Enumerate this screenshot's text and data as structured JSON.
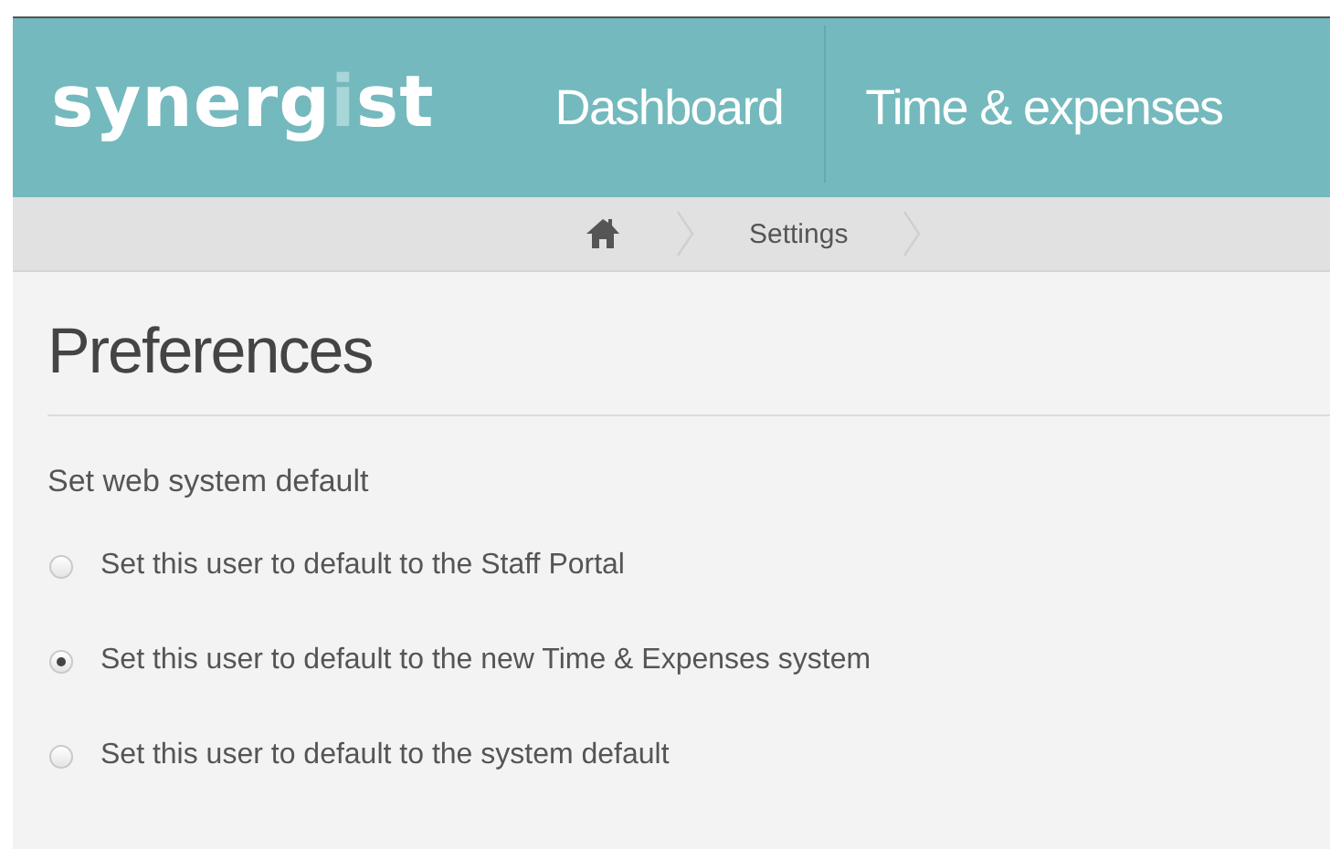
{
  "logo": {
    "before": "synerg",
    "accent": "i",
    "after": "st"
  },
  "nav": [
    {
      "label": "Dashboard"
    },
    {
      "label": "Time & expenses"
    }
  ],
  "breadcrumb": [
    {
      "label": "Settings"
    }
  ],
  "page_title": "Preferences",
  "section": {
    "label": "Set web system default",
    "options": [
      {
        "label": "Set this user to default to the Staff Portal",
        "selected": false
      },
      {
        "label": "Set this user to default to the new Time & Expenses system",
        "selected": true
      },
      {
        "label": "Set this user to default to the system default",
        "selected": false
      }
    ]
  }
}
